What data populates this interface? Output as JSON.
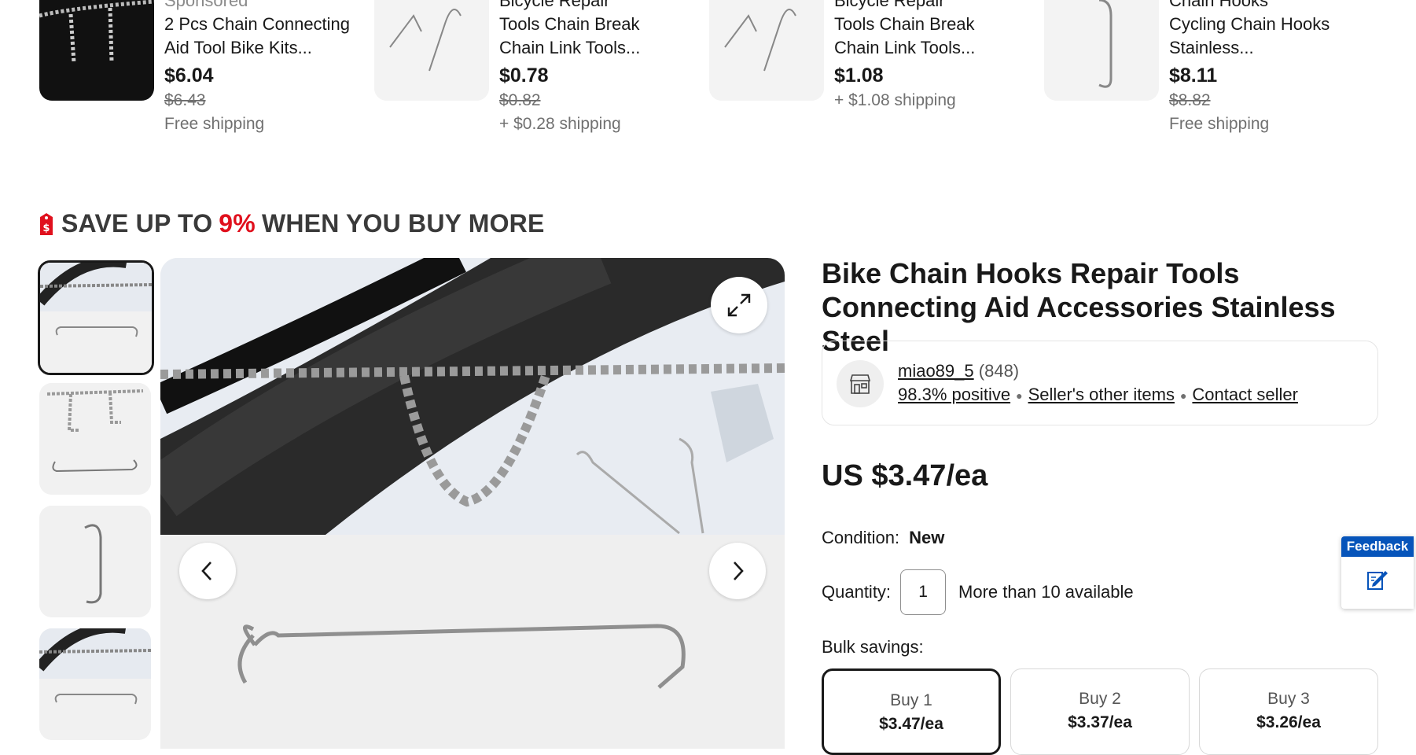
{
  "carousel": [
    {
      "title_top": "Sponsored",
      "title": "2 Pcs Chain Connecting Aid Tool Bike Kits...",
      "price": "$6.04",
      "old_price": "$6.43",
      "shipping": "Free shipping"
    },
    {
      "title_top": "Bicycle Repair",
      "title": "Tools Chain Break Chain Link Tools...",
      "price": "$0.78",
      "old_price": "$0.82",
      "shipping": "+ $0.28 shipping"
    },
    {
      "title_top": "Bicycle Repair",
      "title": "Tools Chain Break Chain Link Tools...",
      "price": "$1.08",
      "old_price": "",
      "shipping": "+ $1.08 shipping"
    },
    {
      "title_top": "Chain Hooks",
      "title": "Cycling Chain Hooks Stainless...",
      "price": "$8.11",
      "old_price": "$8.82",
      "shipping": "Free shipping"
    }
  ],
  "banner": {
    "pre": "SAVE UP TO",
    "pct": "9%",
    "post": "WHEN YOU BUY MORE",
    "icon": "price-tag-icon"
  },
  "product": {
    "title": "Bike Chain Hooks Repair Tools Connecting Aid Accessories Stainless Steel",
    "price": "US $3.47/ea",
    "condition_label": "Condition:",
    "condition_value": "New",
    "quantity_label": "Quantity:",
    "quantity_value": "1",
    "availability": "More than 10 available",
    "bulk_label": "Bulk savings:"
  },
  "seller": {
    "name": "miao89_5",
    "feedback_count": "(848)",
    "positive": "98.3% positive",
    "other_items": "Seller's other items",
    "contact": "Contact seller",
    "icon": "store-icon"
  },
  "bulk_options": [
    {
      "label": "Buy 1",
      "price": "$3.47/ea"
    },
    {
      "label": "Buy 2",
      "price": "$3.37/ea"
    },
    {
      "label": "Buy 3",
      "price": "$3.26/ea"
    }
  ],
  "feedback": {
    "label": "Feedback",
    "icon": "feedback-edit-icon"
  },
  "colors": {
    "accent_red": "#e0101d",
    "feedback_blue": "#0654ba",
    "text": "#191919"
  }
}
